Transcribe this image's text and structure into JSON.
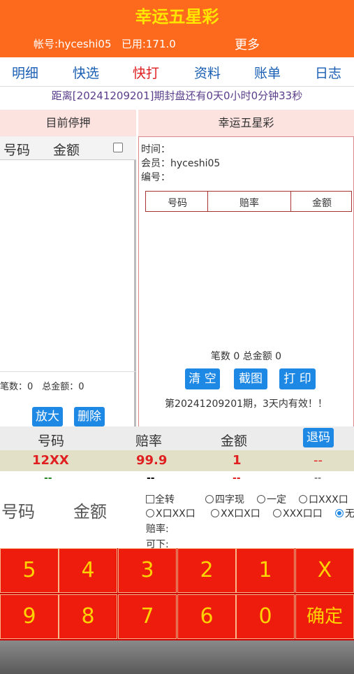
{
  "header": {
    "title": "幸运五星彩",
    "account": "帐号:hyceshi05",
    "used": "已用:171.0",
    "more": "更多"
  },
  "tabs": [
    "明细",
    "快选",
    "快打",
    "资料",
    "账单",
    "日志"
  ],
  "countdown": "距离[20241209201]期封盘还有0天0小时0分钟33秒",
  "left_panel": {
    "title": "目前停押",
    "col_number": "号码",
    "col_amount": "金额",
    "footer": "笔数：0　总金额：0",
    "zoom_button": "放大",
    "delete_button": "删除"
  },
  "right_panel": {
    "title": "幸运五星彩",
    "time_label": "时间：",
    "member_label": "会员：hyceshi05",
    "serial_label": "编号：",
    "table": [
      "号码",
      "赔率",
      "金额"
    ],
    "summary": "笔数 0 总金额 0",
    "clear_button": "清 空",
    "screenshot_button": "截图",
    "print_button": "打 印",
    "note": "第20241209201期，3天内有效！！"
  },
  "bet_table": {
    "headers": [
      "号码",
      "赔率",
      "金额",
      "退码"
    ],
    "row": {
      "number": "12XX",
      "odds": "99.9",
      "amount": "1",
      "refund": "--"
    },
    "row2": {
      "number": "--",
      "odds": "--",
      "amount": "--",
      "refund": "--"
    }
  },
  "input_area": {
    "number_label": "号码",
    "amount_label": "金额",
    "options_row1": [
      "全转",
      "四字现",
      "一定",
      "口XXX口"
    ],
    "options_row2": [
      "X口XX口",
      "XX口X口",
      "XXX口口",
      "无"
    ],
    "odds_label": "赔率:",
    "can_bet_label": "可下:"
  },
  "keypad": [
    "5",
    "4",
    "3",
    "2",
    "1",
    "X",
    "9",
    "8",
    "7",
    "6",
    "0",
    "确定"
  ],
  "colors": {
    "topbar": "#fe6a1d",
    "title": "#ffe600",
    "key_bg": "#ee1c0c",
    "key_text": "#ffd200",
    "accent_blue": "#1e88e5"
  }
}
